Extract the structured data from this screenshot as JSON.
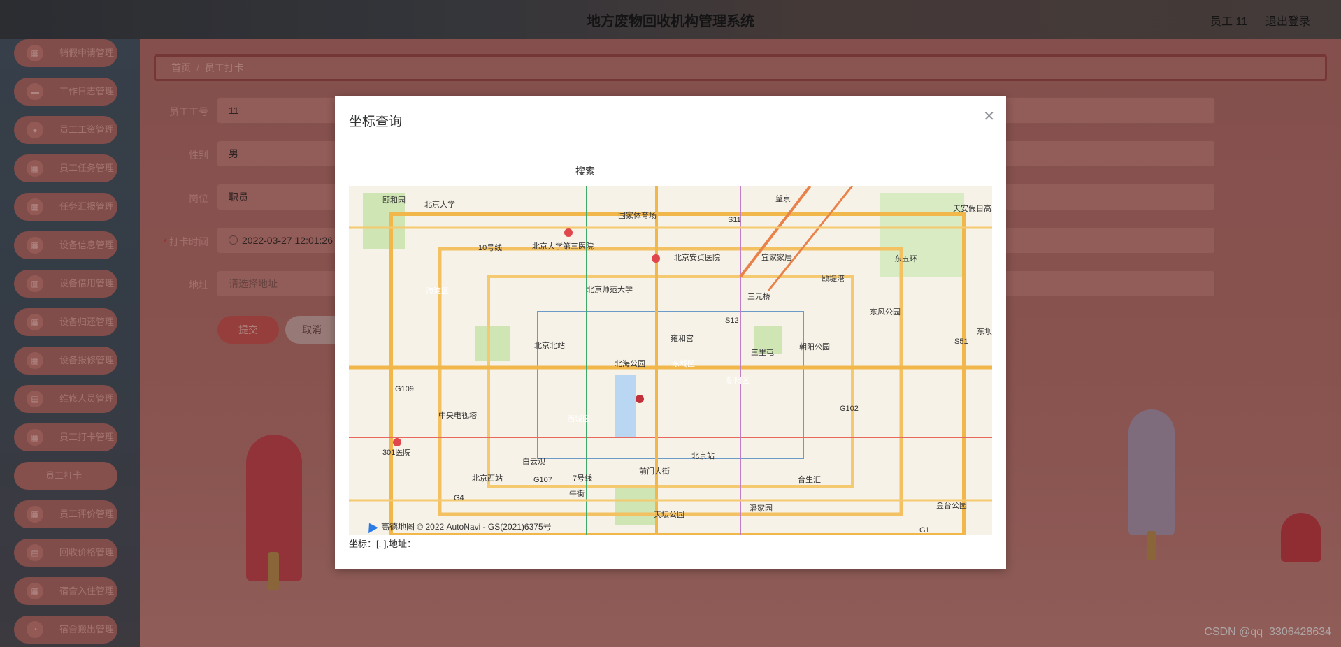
{
  "header": {
    "title": "地方废物回收机构管理系统",
    "user": "员工 11",
    "logout": "退出登录"
  },
  "sidebar": {
    "items": [
      {
        "label": "销假申请管理",
        "icon": "grid-icon"
      },
      {
        "label": "工作日志管理",
        "icon": "chat-icon"
      },
      {
        "label": "员工工资管理",
        "icon": "user-icon"
      },
      {
        "label": "员工任务管理",
        "icon": "grid-icon"
      },
      {
        "label": "任务汇报管理",
        "icon": "grid-icon"
      },
      {
        "label": "设备信息管理",
        "icon": "grid-icon"
      },
      {
        "label": "设备借用管理",
        "icon": "trash-icon"
      },
      {
        "label": "设备归还管理",
        "icon": "grid-icon"
      },
      {
        "label": "设备报修管理",
        "icon": "grid-icon"
      },
      {
        "label": "维修人员管理",
        "icon": "chart-icon"
      },
      {
        "label": "员工打卡管理",
        "icon": "grid-icon"
      },
      {
        "label": "员工打卡",
        "icon": ""
      },
      {
        "label": "员工评价管理",
        "icon": "grid-icon"
      },
      {
        "label": "回收价格管理",
        "icon": "chart-icon"
      },
      {
        "label": "宿舍入住管理",
        "icon": "grid-icon"
      },
      {
        "label": "宿舍搬出管理",
        "icon": "pie-icon"
      }
    ]
  },
  "breadcrumb": {
    "home": "首页",
    "sep": "/",
    "current": "员工打卡"
  },
  "form": {
    "employee_no": {
      "label": "员工工号",
      "value": "11"
    },
    "gender": {
      "label": "性别",
      "value": "男"
    },
    "position": {
      "label": "岗位",
      "value": "职员"
    },
    "checkin_time": {
      "label": "打卡时间",
      "required": "*",
      "value": "2022-03-27 12:01:26"
    },
    "address": {
      "label": "地址",
      "placeholder": "请选择地址"
    },
    "submit": "提交",
    "cancel": "取消"
  },
  "modal": {
    "title": "坐标查询",
    "search_button": "搜索",
    "coords": "坐标：[, ],地址：",
    "attribution": "高德地图 © 2022 AutoNavi - GS(2021)6375号",
    "map_labels": [
      "颐和园",
      "北京大学",
      "国家体育场",
      "北京大学第三医院",
      "北京安贞医院",
      "宜家家居",
      "颐堤港",
      "东五环",
      "海淀区",
      "北京师范大学",
      "三元桥",
      "东风公园",
      "雍和宫",
      "北京北站",
      "朝阳公园",
      "北海公园",
      "东城区",
      "朝阳区",
      "中央电视塔",
      "西城区",
      "北京站",
      "301医院",
      "白云观",
      "北京西站",
      "前门大街",
      "合生汇",
      "天坛公园",
      "金台公园",
      "天安假日高尔夫俱乐部",
      "东坝",
      "S11",
      "S12",
      "G109",
      "G102",
      "G107",
      "G4",
      "S51",
      "G1",
      "望京",
      "三里屯",
      "潘家园",
      "牛街",
      "10号线",
      "7号线"
    ]
  },
  "watermark": "CSDN @qq_3306428634"
}
